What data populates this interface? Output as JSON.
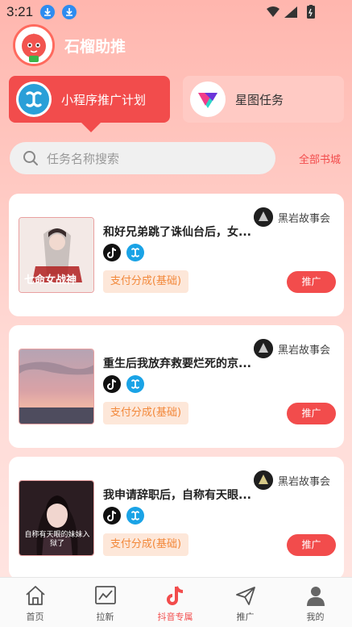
{
  "status_bar": {
    "time": "3:21"
  },
  "app": {
    "name": "石榴助推"
  },
  "tabs": [
    {
      "label": "小程序推广计划",
      "active": true
    },
    {
      "label": "星图任务",
      "active": false
    }
  ],
  "search": {
    "placeholder": "任务名称搜索",
    "all_books_link": "全部书城"
  },
  "tasks": [
    {
      "title": "和好兄弟跳了诛仙台后，女...",
      "author": "黑岩故事会",
      "reward": "支付分成(基础)",
      "action": "推广",
      "cover_text": "七命女战神"
    },
    {
      "title": "重生后我放弃救要烂死的京...",
      "author": "黑岩故事会",
      "reward": "支付分成(基础)",
      "action": "推广"
    },
    {
      "title": "我申请辞职后，自称有天眼...",
      "author": "黑岩故事会",
      "reward": "支付分成(基础)",
      "action": "推广",
      "cover_text": "自称有天眼的妹妹入狱了"
    }
  ],
  "nav": [
    {
      "label": "首页",
      "icon": "home-icon"
    },
    {
      "label": "拉新",
      "icon": "chart-icon"
    },
    {
      "label": "抖音专属",
      "icon": "tiktok-icon",
      "active": true
    },
    {
      "label": "推广",
      "icon": "send-icon"
    },
    {
      "label": "我的",
      "icon": "user-icon"
    }
  ],
  "colors": {
    "accent": "#f24c4c",
    "badge_text": "#f2883a",
    "badge_bg": "#fde7d9"
  }
}
